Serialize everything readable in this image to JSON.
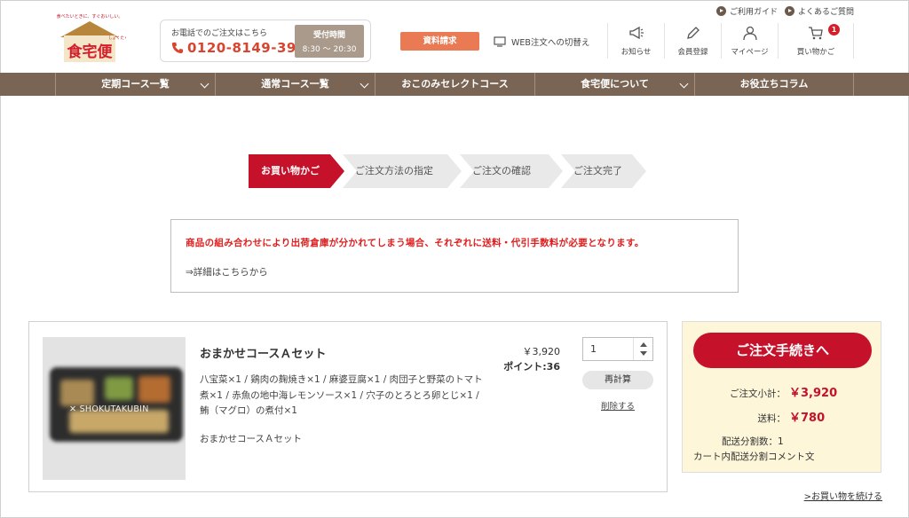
{
  "logo": {
    "tagline": "食べたいときに、すぐおいしい。",
    "name": "食宅便"
  },
  "phone": {
    "label": "お電話でのご注文はこちら",
    "number": "0120-8149-39",
    "hours_title": "受付時間",
    "hours": "8:30 ～ 20:30"
  },
  "header": {
    "request_button": "資料請求",
    "web_switch": "WEB注文への切替え",
    "top_links": [
      "ご利用ガイド",
      "よくあるご質問"
    ],
    "icons": [
      {
        "label": "お知らせ",
        "icon": "megaphone-icon"
      },
      {
        "label": "会員登録",
        "icon": "pencil-icon"
      },
      {
        "label": "マイページ",
        "icon": "user-icon"
      },
      {
        "label": "買い物かご",
        "icon": "cart-icon",
        "badge": "1"
      }
    ]
  },
  "nav": [
    "定期コース一覧",
    "通常コース一覧",
    "おこのみセレクトコース",
    "食宅便について",
    "お役立ちコラム"
  ],
  "steps": [
    "お買い物かご",
    "ご注文方法の指定",
    "ご注文の確認",
    "ご注文完了"
  ],
  "notice": {
    "warning": "商品の組み合わせにより出荷倉庫が分かれてしまう場合、それぞれに送料・代引手数料が必要となります。",
    "link": "⇒詳細はこちらから"
  },
  "item": {
    "watermark": "✕ SHOKUTAKUBIN",
    "title": "おまかせコースＡセット",
    "description": "八宝菜×1 / 鶏肉の麹焼き×1 / 麻婆豆腐×1 / 肉団子と野菜のトマト煮×1 / 赤魚の地中海レモンソース×1 / 穴子のとろとろ卵とじ×1 / 鮪（マグロ）の煮付×1",
    "subtitle": "おまかせコースＡセット",
    "price": "￥3,920",
    "points": "ポイント:36",
    "quantity": "1",
    "recalc_button": "再計算",
    "delete_link": "削除する"
  },
  "summary": {
    "checkout_button": "ご注文手続きへ",
    "subtotal_label": "ご注文小計：",
    "subtotal": "￥3,920",
    "shipping_label": "送料：",
    "shipping": "￥780",
    "split_count": "配送分割数：1",
    "split_comment": "カート内配送分割コメント文"
  },
  "continue_link": ">お買い物を続ける",
  "colors": {
    "brand_red": "#c5112a",
    "nav_brown": "#7a6554",
    "warning_red": "#e01e1e",
    "summary_bg": "#fdf6d9"
  }
}
